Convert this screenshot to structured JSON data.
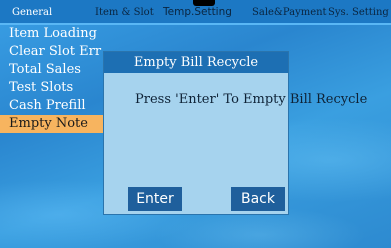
{
  "tabs": {
    "general": "General",
    "item_slot": "Item & Slot",
    "temp_setting": "Temp.Setting",
    "sale_payment": "Sale&Payment",
    "sys_setting": "Sys. Setting"
  },
  "menu": {
    "items": [
      "Item Loading",
      "Clear Slot Err",
      "Total Sales",
      "Test Slots",
      "Cash Prefill",
      "Empty Note"
    ],
    "selected": "Empty Note"
  },
  "dialog": {
    "title": "Empty Bill Recycle",
    "message": "Press 'Enter' To Empty Bill Recycle",
    "enter_label": "Enter",
    "back_label": "Back"
  },
  "colors": {
    "background": "#2f8fd6",
    "topbar": "#1c78c4",
    "selected_item": "#f7b45f",
    "dialog_body": "#a6d3ee",
    "dialog_title": "#1d6fb3",
    "button": "#1f5f9c"
  }
}
